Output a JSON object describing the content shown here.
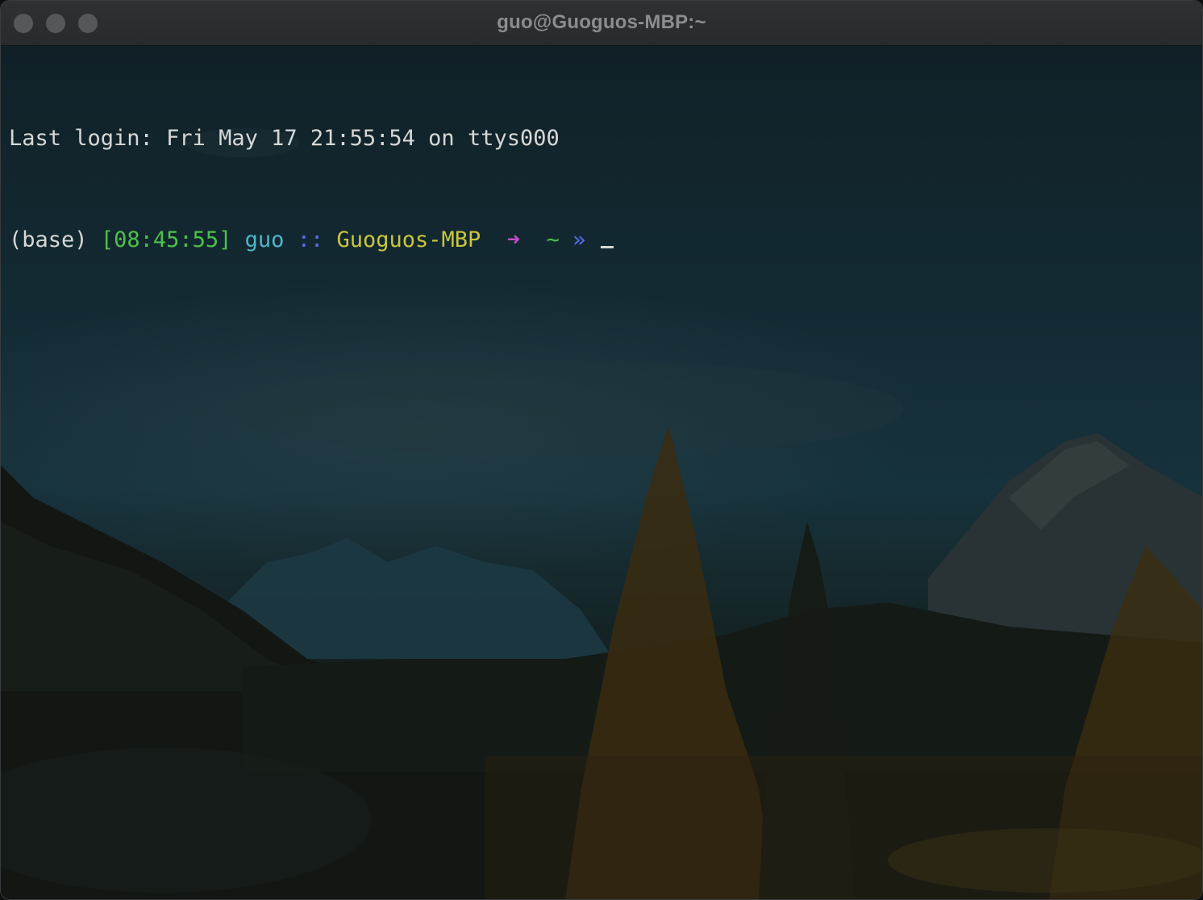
{
  "window": {
    "title": "guo@Guoguos-MBP:~"
  },
  "terminal": {
    "last_login": "Last login: Fri May 17 21:55:54 on ttys000",
    "prompt": {
      "env": "(base)",
      "time": "[08:45:55]",
      "user": "guo",
      "separator": "::",
      "host": "Guoguos-MBP",
      "arrow": "➜",
      "cwd": "~",
      "chevron": "»"
    }
  },
  "colors": {
    "env": "#d6d8d6",
    "time": "#4fc04a",
    "user": "#4fb6c8",
    "separator": "#5a6cf0",
    "host": "#c9c63c",
    "arrow": "#c24ccd",
    "cwd": "#4fc04a",
    "chevron": "#5a6cf0"
  }
}
